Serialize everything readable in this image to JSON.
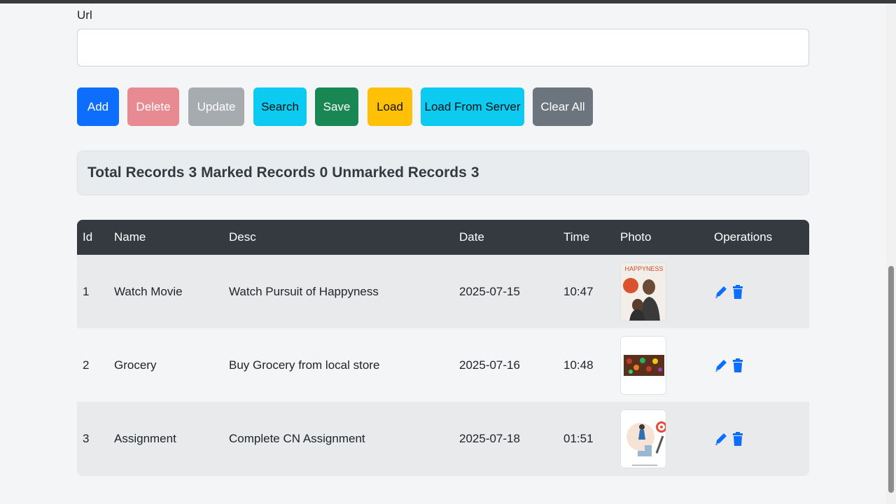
{
  "form": {
    "url_label": "Url",
    "url_value": "",
    "url_placeholder": ""
  },
  "buttons": {
    "add": "Add",
    "delete": "Delete",
    "update": "Update",
    "search": "Search",
    "save": "Save",
    "load": "Load",
    "load_server": "Load From Server",
    "clear_all": "Clear All"
  },
  "summary": {
    "total_label": "Total Records",
    "total": "3",
    "marked_label": "Marked Records",
    "marked": "0",
    "unmarked_label": "Unmarked Records",
    "unmarked": "3"
  },
  "table": {
    "headers": [
      "Id",
      "Name",
      "Desc",
      "Date",
      "Time",
      "Photo",
      "Operations"
    ],
    "rows": [
      {
        "id": "1",
        "name": "Watch Movie",
        "desc": "Watch Pursuit of Happyness",
        "date": "2025-07-15",
        "time": "10:47",
        "photo": "movie-poster-thumbnail"
      },
      {
        "id": "2",
        "name": "Grocery",
        "desc": "Buy Grocery from local store",
        "date": "2025-07-16",
        "time": "10:48",
        "photo": "grocery-thumbnail"
      },
      {
        "id": "3",
        "name": "Assignment",
        "desc": "Complete CN Assignment",
        "date": "2025-07-18",
        "time": "01:51",
        "photo": "assignment-thumbnail"
      }
    ],
    "poster_text": "HAPPYNESS"
  },
  "colors": {
    "primary": "#0d6efd",
    "header_bg": "#343a40",
    "icon": "#0d6efd"
  },
  "icons": [
    "pencil-icon",
    "trash-icon"
  ]
}
